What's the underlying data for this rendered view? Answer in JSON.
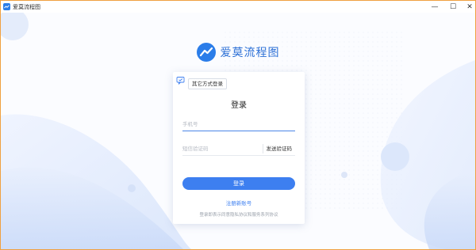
{
  "window": {
    "title": "爱莫流程图",
    "minimize_glyph": "—",
    "maximize_glyph": "☐",
    "close_glyph": "✕"
  },
  "brand": {
    "name": "爱莫流程图",
    "accent": "#2b6fd6"
  },
  "login": {
    "other_methods": "其它方式登录",
    "title": "登录",
    "phone_placeholder": "手机号",
    "phone_value": "",
    "code_placeholder": "短信验证码",
    "code_value": "",
    "send_code": "发送验证码",
    "submit": "登录",
    "register": "注册新账号",
    "agreement": "登录即表示同意隐私协议和服务系列协议"
  },
  "colors": {
    "primary": "#3d7ff0",
    "window_border": "#f0a040"
  }
}
